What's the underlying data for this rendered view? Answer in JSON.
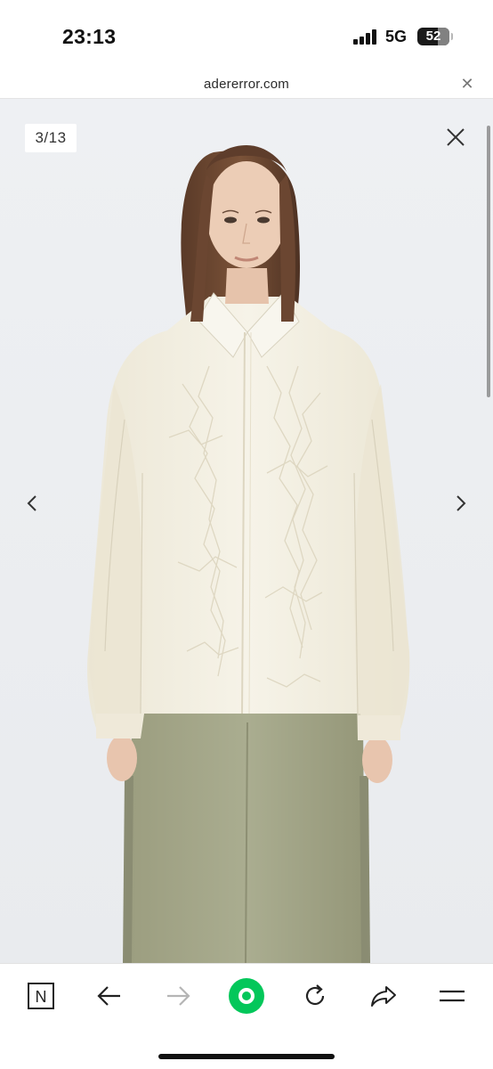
{
  "status_bar": {
    "time": "23:13",
    "network": "5G",
    "battery": "52"
  },
  "browser": {
    "url": "adererror.com",
    "close_icon": "close-icon"
  },
  "viewer": {
    "counter": "3/13",
    "close_icon": "close-icon",
    "prev_icon": "chevron-left-icon",
    "next_icon": "chevron-right-icon",
    "image_alt": "Product photo",
    "colors": {
      "background": "#eef0f3",
      "shirt": "#f3efe2",
      "pants": "#a7a98c"
    }
  },
  "toolbar": {
    "items": [
      {
        "name": "naver-home-icon",
        "label": "N"
      },
      {
        "name": "back-arrow-icon"
      },
      {
        "name": "forward-arrow-icon"
      },
      {
        "name": "green-search-icon"
      },
      {
        "name": "reload-icon"
      },
      {
        "name": "share-icon"
      },
      {
        "name": "menu-icon"
      }
    ],
    "accent": "#03c75a"
  }
}
